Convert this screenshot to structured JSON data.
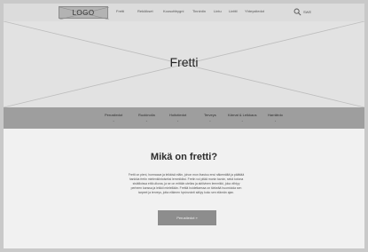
{
  "header": {
    "logo": "LOGO",
    "nav": [
      "Fretti",
      "Reköikset",
      "Koosotttrygni",
      "Tinnintin",
      "Lintu",
      "Lintttl",
      "Yhteystiedot"
    ],
    "language": "SWE",
    "icons": {
      "search": "search-icon"
    }
  },
  "hero": {
    "title": "Fretti"
  },
  "subnav": {
    "items": [
      "Perustiedot",
      "Ruokinolla",
      "Hoitotiedot",
      "Terveys",
      "Kärnat & Leikkaus",
      "Harrätrdo"
    ]
  },
  "content": {
    "title": "Mikä on fretti?",
    "body_lines": [
      "Fretti on pieni, hurmaava ja leikkisä eläin, johon mon ihastuu ensi näkemältä ja päättää",
      "hankkia fretin mielenkiintoiseksi lemmikiksi. Fretin voi pitää monin tavoin, sekä kotona",
      "sisätiloissa että ulkona, ja se on erittäin utelias ja aktiivinen lemmikki, joka viihtyy",
      "perheen kanssa ja leikkii mielellään. Frettiä hoidettaessa on tärkeää huomioida sen",
      "tarpeet ja terveys, jotta eläimen hyvinvointi säilyy koko sen elämän ajan."
    ],
    "cta_label": "Perustiedot »"
  },
  "colors": {
    "background": "#c9c9c9",
    "page": "#f1f1f1",
    "topnav": "#dcdcdc",
    "hero": "#e2e2e2",
    "subnav": "#9e9e9e",
    "button": "#8d8d8d"
  }
}
